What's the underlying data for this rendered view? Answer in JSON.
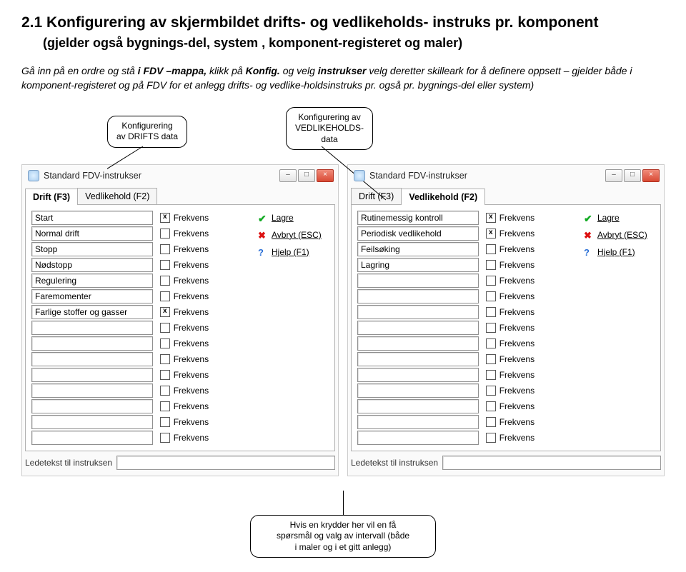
{
  "heading": "2.1 Konfigurering av skjermbildet drifts- og vedlikeholds- instruks pr. komponent",
  "subheading": "(gjelder også bygnings-del, system , komponent-registeret og maler)",
  "intro_plain1": "Gå inn på en ordre og stå ",
  "intro_bold1": "i FDV –mappa, ",
  "intro_plain2": "klikk på ",
  "intro_bold2": "Konfig.",
  "intro_plain3": " og velg ",
  "intro_bold3": "instrukser  ",
  "intro_rest": "velg deretter skilleark for å definere oppsett – gjelder både i komponent-registeret og på FDV for et anlegg  drifts- og vedlike-holdsinstruks pr. også pr. bygnings-del eller system)",
  "callout1_l1": "Konfigurering",
  "callout1_l2": "av DRIFTS data",
  "callout2_l1": "Konfigurering av",
  "callout2_l2": "VEDLIKEHOLDS-",
  "callout2_l3": "data",
  "win": {
    "title": "Standard FDV-instrukser",
    "tab_drift": "Drift (F3)",
    "tab_vedl": "Vedlikehold (F2)",
    "frekvens": "Frekvens",
    "lagre": "Lagre",
    "avbryt": "Avbryt (ESC)",
    "hjelp": "Hjelp (F1)",
    "footerlabel": "Ledetekst til instruksen",
    "left_items": [
      "Start",
      "Normal drift",
      "Stopp",
      "Nødstopp",
      "Regulering",
      "Faremomenter",
      "Farlige stoffer og gasser"
    ],
    "right_items": [
      "Rutinemessig kontroll",
      "Periodisk vedlikehold",
      "Feilsøking",
      "Lagring"
    ],
    "checks_left": [
      true,
      false,
      false,
      false,
      false,
      false,
      true,
      false,
      false,
      false,
      false,
      false,
      false,
      false,
      false
    ],
    "checks_right": [
      true,
      true,
      false,
      false,
      false,
      false,
      false,
      false,
      false,
      false,
      false,
      false,
      false,
      false,
      false
    ]
  },
  "bottom_l1": "Hvis en krydder her vil en få",
  "bottom_l2": "spørsmål og valg av intervall (både",
  "bottom_l3": "i maler og i et gitt anlegg)"
}
